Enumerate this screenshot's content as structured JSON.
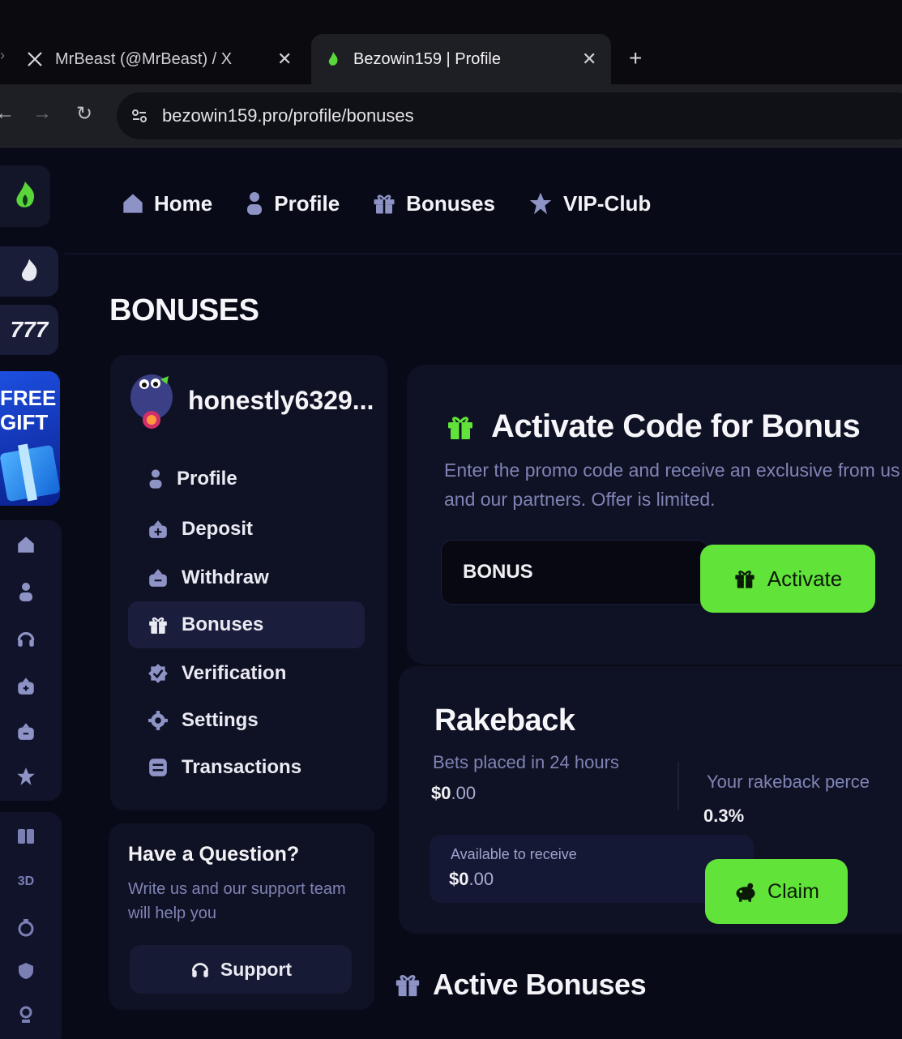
{
  "browser": {
    "tabs": [
      {
        "title": "MrBeast (@MrBeast) / X",
        "favicon": "x-logo-icon"
      },
      {
        "title": "Bezowin159 | Profile",
        "favicon": "site-flame-icon",
        "active": true
      }
    ],
    "new_tab": "+",
    "url": "bezowin159.pro/profile/bonuses"
  },
  "nav": {
    "items": [
      {
        "label": "Home",
        "icon": "home-icon"
      },
      {
        "label": "Profile",
        "icon": "user-icon"
      },
      {
        "label": "Bonuses",
        "icon": "gift-icon"
      },
      {
        "label": "VIP-Club",
        "icon": "star-icon"
      }
    ]
  },
  "rail": {
    "gift_promo": "FREE GIFT"
  },
  "page": {
    "title": "BONUSES"
  },
  "profile_menu": {
    "username": "honestly6329...",
    "items": [
      {
        "label": "Profile",
        "icon": "user-icon"
      },
      {
        "label": "Deposit",
        "icon": "wallet-plus-icon"
      },
      {
        "label": "Withdraw",
        "icon": "wallet-minus-icon"
      },
      {
        "label": "Bonuses",
        "icon": "gift-icon",
        "active": true
      },
      {
        "label": "Verification",
        "icon": "verified-badge-icon"
      },
      {
        "label": "Settings",
        "icon": "gear-icon"
      },
      {
        "label": "Transactions",
        "icon": "receipt-icon"
      }
    ]
  },
  "question": {
    "title": "Have a Question?",
    "text": "Write us and our support team will help you",
    "button": "Support"
  },
  "activate_code": {
    "title": "Activate Code for Bonus",
    "description": "Enter the promo code and receive an exclusive from us and our partners. Offer is limited.",
    "input_value": "BONUS",
    "button": "Activate"
  },
  "rakeback": {
    "title": "Rakeback",
    "bets_label": "Bets placed in 24 hours",
    "bets_value_main": "$0",
    "bets_value_cents": ".00",
    "percent_label": "Your rakeback perce",
    "percent_value": "0.3%",
    "available_label": "Available to receive",
    "available_value_main": "$0",
    "available_value_cents": ".00",
    "button": "Claim"
  },
  "active_bonuses": {
    "title": "Active Bonuses"
  },
  "colors": {
    "accent_green": "#61e33a",
    "muted_text": "#7f84b4",
    "card_bg": "#0f1124",
    "page_bg": "#090a18"
  }
}
